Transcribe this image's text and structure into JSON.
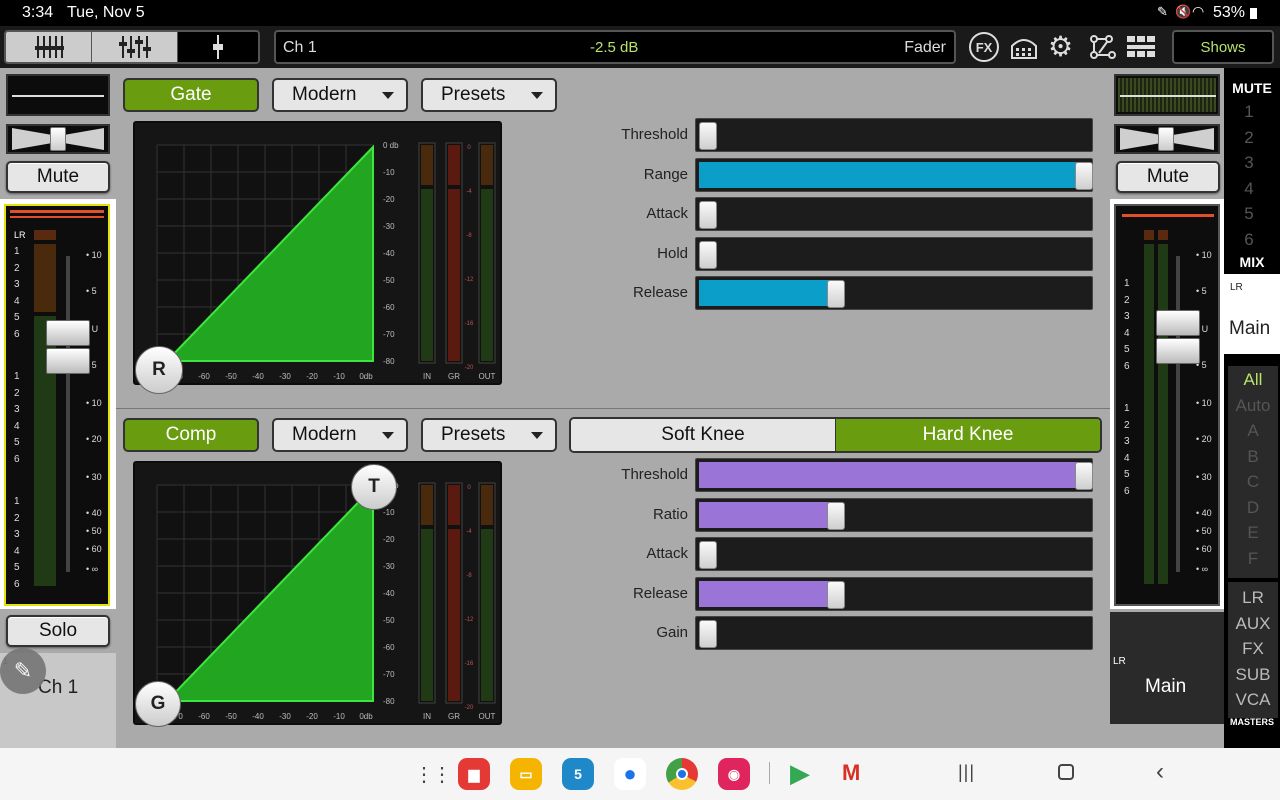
{
  "status": {
    "time": "3:34",
    "date": "Tue, Nov 5",
    "battery": "53%"
  },
  "topbar": {
    "channel": "Ch 1",
    "level": "-2.5 dB",
    "mode": "Fader",
    "fx_label": "FX",
    "shows_label": "Shows"
  },
  "left_strip": {
    "mute_label": "Mute",
    "solo_label": "Solo",
    "channel_name": "Ch 1",
    "lr_label": "LR",
    "lr_tag": "1"
  },
  "gate": {
    "toggle_label": "Gate",
    "model": "Modern",
    "presets_label": "Presets",
    "handle_label": "R",
    "params": [
      {
        "label": "Threshold",
        "value": 0.0
      },
      {
        "label": "Range",
        "value": 1.0
      },
      {
        "label": "Attack",
        "value": 0.0
      },
      {
        "label": "Hold",
        "value": 0.0
      },
      {
        "label": "Release",
        "value": 0.34
      }
    ]
  },
  "comp": {
    "toggle_label": "Comp",
    "model": "Modern",
    "presets_label": "Presets",
    "soft_knee_label": "Soft Knee",
    "hard_knee_label": "Hard Knee",
    "threshold_handle": "T",
    "gain_handle": "G",
    "params": [
      {
        "label": "Threshold",
        "value": 1.0
      },
      {
        "label": "Ratio",
        "value": 0.34
      },
      {
        "label": "Attack",
        "value": 0.0
      },
      {
        "label": "Release",
        "value": 0.34
      },
      {
        "label": "Gain",
        "value": 0.0
      }
    ]
  },
  "graph": {
    "x_ticks": [
      "-70",
      "-60",
      "-50",
      "-40",
      "-30",
      "-20",
      "-10",
      "0db"
    ],
    "y_ticks": [
      "0 db",
      "-10",
      "-20",
      "-30",
      "-40",
      "-50",
      "-60",
      "-70",
      "-80"
    ],
    "meter_labels": [
      "IN",
      "GR",
      "OUT"
    ],
    "gr_ticks": [
      "0",
      "-4",
      "-8",
      "-12",
      "-16",
      "-20"
    ]
  },
  "fader_scale": [
    "10",
    "5",
    "U",
    "5",
    "10",
    "20",
    "30",
    "40",
    "50",
    "60",
    "∞"
  ],
  "meter_nums": [
    "1",
    "2",
    "3",
    "4",
    "5",
    "6",
    "1",
    "2",
    "3",
    "4",
    "5",
    "6",
    "1",
    "2",
    "3",
    "4",
    "5",
    "6"
  ],
  "right_strip": {
    "mute_label": "Mute",
    "name": "Main",
    "lr_label": "LR"
  },
  "right_panel": {
    "mute_header": "MUTE",
    "mute_groups": [
      "1",
      "2",
      "3",
      "4",
      "5",
      "6"
    ],
    "mix_header": "MIX",
    "mix_lr": "LR",
    "mix_name": "Main",
    "filters": [
      "All",
      "Auto",
      "A",
      "B",
      "C",
      "D",
      "E",
      "F"
    ],
    "masters": [
      "LR",
      "AUX",
      "FX",
      "SUB",
      "VCA"
    ],
    "masters_label": "MASTERS"
  },
  "colors": {
    "green": "#6a9c10",
    "blue": "#0a9ec9",
    "purple": "#9b74d8",
    "graph_fill": "#22a622"
  }
}
